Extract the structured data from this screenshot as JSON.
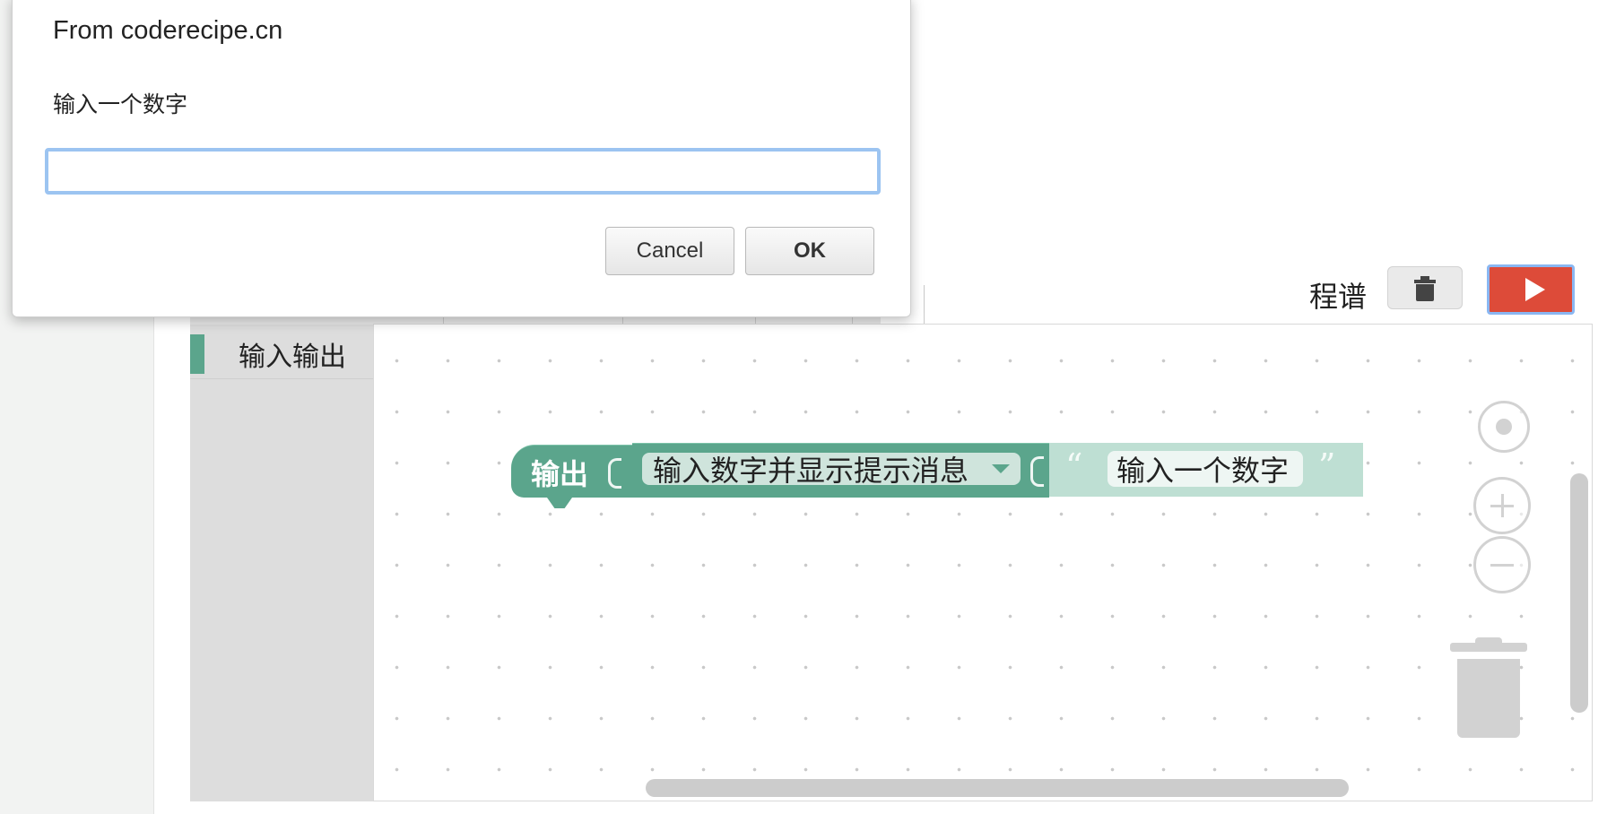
{
  "dialog": {
    "title": "From coderecipe.cn",
    "message": "输入一个数字",
    "input_value": "",
    "cancel_label": "Cancel",
    "ok_label": "OK"
  },
  "toolbar": {
    "program_label": "程谱",
    "trash_icon": "trash-icon",
    "run_icon": "play-icon",
    "run_color": "#dd4b39"
  },
  "toolbox": {
    "categories": [
      {
        "label": "输入输出",
        "color": "#5ba58c"
      }
    ]
  },
  "workspace": {
    "block": {
      "statement_label": "输出",
      "dropdown_value": "输入数字并显示提示消息",
      "text_value": "输入一个数字",
      "color": "#5ba58c",
      "text_block_color": "#bedfd3"
    },
    "controls": {
      "center_icon": "target-icon",
      "zoom_in_icon": "zoom-in-icon",
      "zoom_out_icon": "zoom-out-icon",
      "trash_icon": "trash-icon"
    }
  }
}
